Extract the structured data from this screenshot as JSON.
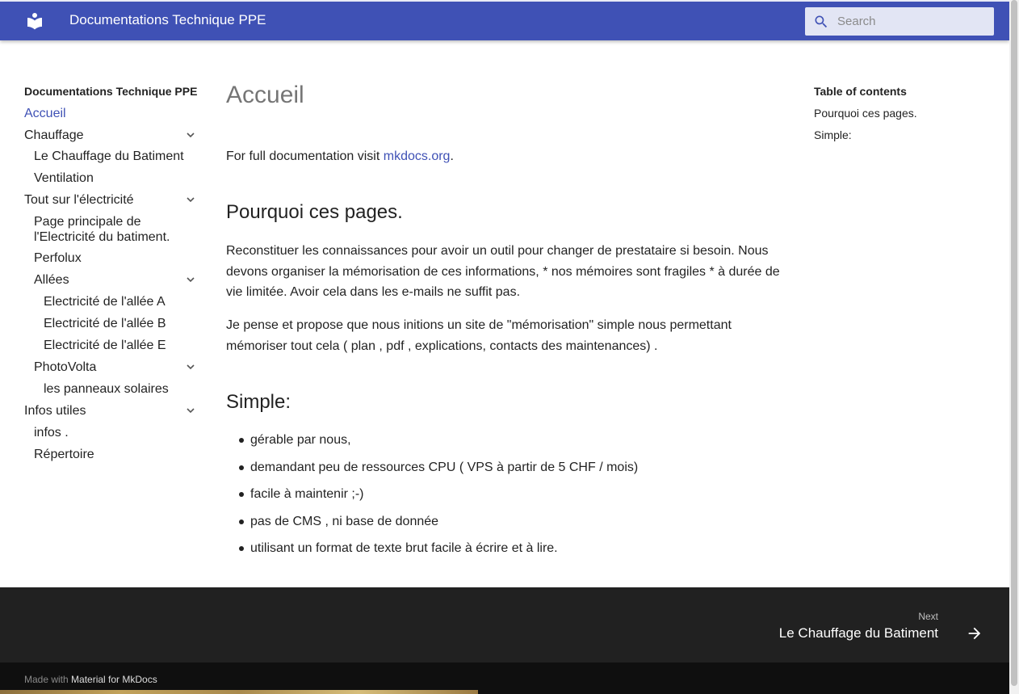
{
  "header": {
    "logo_icon": "book-icon",
    "site_title": "Documentations Technique PPE",
    "search_placeholder": "Search",
    "search_icon": "search-icon"
  },
  "nav": {
    "title": "Documentations Technique PPE",
    "items": [
      {
        "label": "Accueil",
        "active": true
      },
      {
        "label": "Chauffage",
        "expandable": true
      },
      {
        "label": "Le Chauffage du Batiment"
      },
      {
        "label": "Ventilation"
      },
      {
        "label": "Tout sur l'électricité",
        "expandable": true
      },
      {
        "label": "Page principale de l'Electricité du batiment."
      },
      {
        "label": "Perfolux"
      },
      {
        "label": "Allées",
        "expandable": true
      },
      {
        "label": "Electricité de l'allée A"
      },
      {
        "label": "Electricité de l'allée B"
      },
      {
        "label": "Electricité de l'allée E"
      },
      {
        "label": "PhotoVolta",
        "expandable": true
      },
      {
        "label": "les panneaux solaires"
      },
      {
        "label": "Infos utiles",
        "expandable": true
      },
      {
        "label": "infos ."
      },
      {
        "label": "Répertoire"
      }
    ]
  },
  "main": {
    "title": "Accueil",
    "intro_prefix": "For full documentation visit ",
    "intro_link": "mkdocs.org",
    "intro_suffix": ".",
    "section1_title": "Pourquoi ces pages.",
    "section1_p1": "Reconstituer les connaissances pour avoir un outil pour changer de prestataire si besoin. Nous devons organiser la mémorisation de ces informations, * nos mémoires sont fragiles * à durée de vie limitée. Avoir cela dans les e-mails ne suffit pas.",
    "section1_p2": "Je pense et propose que nous initions un site de \"mémorisation\" simple nous permettant mémoriser tout cela ( plan , pdf , explications, contacts des maintenances) .",
    "section2_title": "Simple:",
    "list": [
      "gérable par nous,",
      "demandant peu de ressources CPU ( VPS à partir de 5 CHF / mois)",
      "facile à maintenir ;-)",
      "pas de CMS , ni base de donnée",
      "utilisant un format de texte brut facile à écrire et à lire."
    ]
  },
  "toc": {
    "title": "Table of contents",
    "items": [
      "Pourquoi ces pages.",
      "Simple:"
    ]
  },
  "footer": {
    "next_label": "Next",
    "next_title": "Le Chauffage du Batiment",
    "made_with_prefix": "Made with ",
    "made_with_link": "Material for MkDocs"
  },
  "colors": {
    "primary": "#3f51b5",
    "footer": "#212121",
    "footer_meta": "#0f0f0f"
  }
}
